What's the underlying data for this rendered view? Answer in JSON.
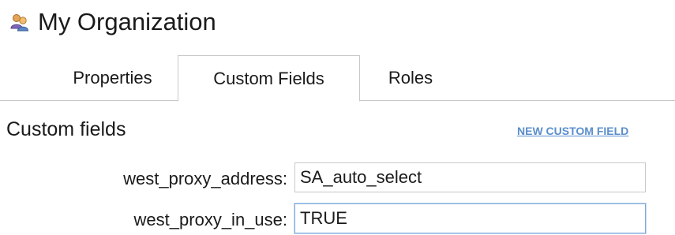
{
  "header": {
    "title": "My Organization",
    "icon": "users-icon"
  },
  "tabs": [
    {
      "label": "Properties",
      "active": false
    },
    {
      "label": "Custom Fields",
      "active": true
    },
    {
      "label": "Roles",
      "active": false
    }
  ],
  "section": {
    "title": "Custom fields",
    "new_link": "NEW CUSTOM FIELD"
  },
  "fields": [
    {
      "label": "west_proxy_address:",
      "value": "SA_auto_select"
    },
    {
      "label": "west_proxy_in_use:",
      "value": "TRUE"
    }
  ],
  "colors": {
    "link": "#5a8ecb",
    "border": "#c8c8c8",
    "focus_border": "#7fa9dd"
  }
}
